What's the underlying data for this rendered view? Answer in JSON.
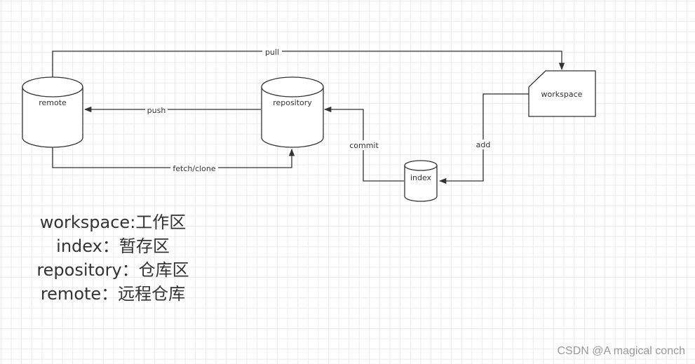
{
  "nodes": {
    "remote": {
      "label": "remote",
      "shape": "cylinder"
    },
    "repository": {
      "label": "repository",
      "shape": "cylinder"
    },
    "index": {
      "label": "index",
      "shape": "cylinder"
    },
    "workspace": {
      "label": "workspace",
      "shape": "card"
    }
  },
  "edges": [
    {
      "id": "pull",
      "label": "pull",
      "from": "remote",
      "to": "workspace"
    },
    {
      "id": "push",
      "label": "push",
      "from": "repository",
      "to": "remote"
    },
    {
      "id": "fetch-clone",
      "label": "fetch/clone",
      "from": "remote",
      "to": "repository"
    },
    {
      "id": "commit",
      "label": "commit",
      "from": "index",
      "to": "repository"
    },
    {
      "id": "add",
      "label": "add",
      "from": "workspace",
      "to": "index"
    }
  ],
  "legend": [
    "workspace:工作区",
    "index：暂存区",
    "repository：仓库区",
    "remote：远程仓库"
  ],
  "watermark": "CSDN @A magical conch",
  "colors": {
    "stroke": "#333333",
    "grid": "#ebebeb",
    "watermark": "#999999"
  }
}
